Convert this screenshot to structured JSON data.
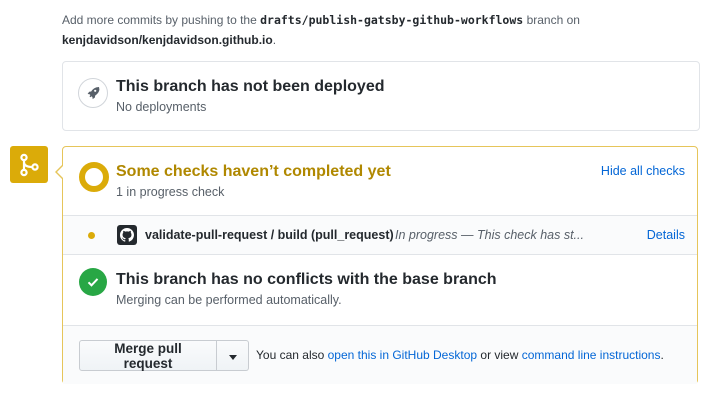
{
  "intro": {
    "prefix": "Add more commits by pushing to the",
    "branch": "drafts/publish-gatsby-github-workflows",
    "suffix": "branch on",
    "repo": "kenjdavidson/kenjdavidson.github.io",
    "end": "."
  },
  "deployment": {
    "icon": "rocket-icon",
    "title": "This branch has not been deployed",
    "subtitle": "No deployments"
  },
  "checks": {
    "badge_icon": "git-branch-icon",
    "title": "Some checks haven’t completed yet",
    "subtitle": "1 in progress check",
    "toggle_label": "Hide all checks",
    "items": [
      {
        "name": "validate-pull-request / build (pull_request)",
        "status": "In progress — This check has st...",
        "details_label": "Details",
        "icon": "github-logo-icon"
      }
    ]
  },
  "conflicts": {
    "title": "This branch has no conflicts with the base branch",
    "subtitle": "Merging can be performed automatically."
  },
  "merge": {
    "button_label": "Merge pull request",
    "hint_prefix": "You can also",
    "desktop_link": "open this in GitHub Desktop",
    "hint_middle": "or view",
    "cli_link": "command line instructions",
    "hint_end": "."
  },
  "colors": {
    "pending": "#dbab09",
    "pending_title": "#b08800",
    "success": "#28a745",
    "link": "#0366d6"
  }
}
